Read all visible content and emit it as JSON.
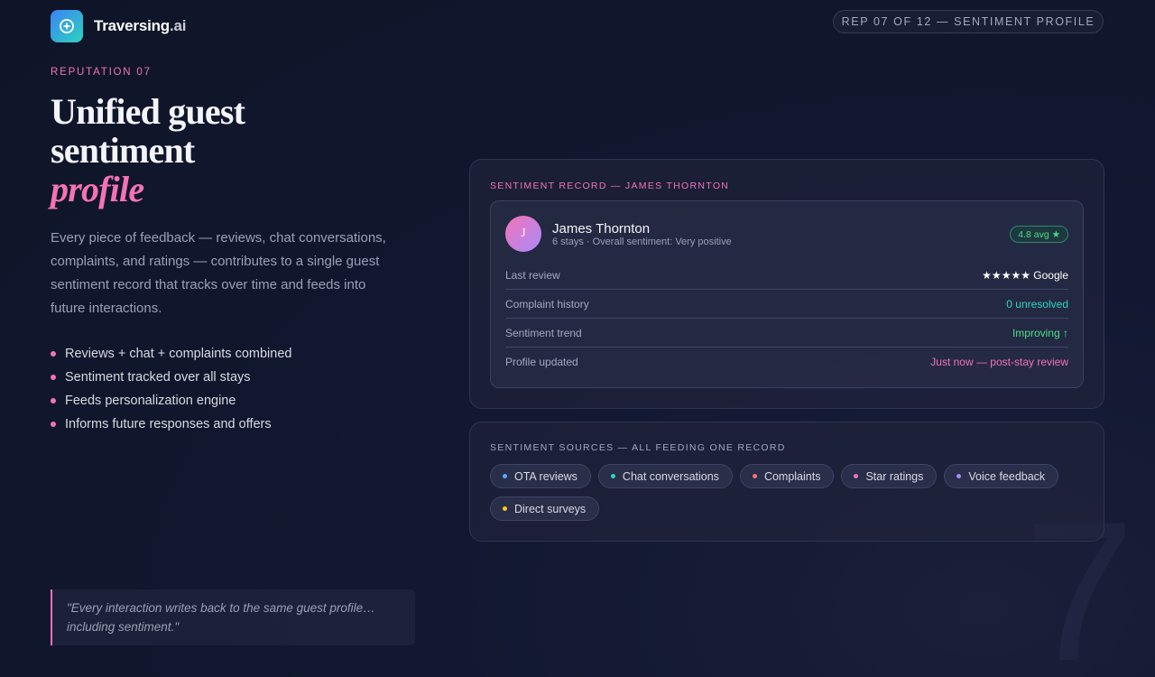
{
  "brand": {
    "name": "Traversing",
    "suffix": ".ai",
    "icon": "compass-plus-icon"
  },
  "rep_indicator": "REP 07 OF 12 — SENTIMENT PROFILE",
  "hero": {
    "eyebrow": "REPUTATION 07",
    "title_line1": "Unified guest",
    "title_line2": "sentiment",
    "title_accent": "profile",
    "description": "Every piece of feedback — reviews, chat conversations, complaints, and ratings — contributes to a single guest sentiment record that tracks over time and feeds into future interactions."
  },
  "bullets": [
    "Reviews + chat + complaints combined",
    "Sentiment tracked over all stays",
    "Feeds personalization engine",
    "Informs future responses and offers"
  ],
  "quote": "\"Every interaction writes back to the same guest profile… including sentiment.\"",
  "record": {
    "label": "SENTIMENT RECORD — JAMES THORNTON",
    "avatar_initial": "J",
    "guest_name": "James Thornton",
    "guest_meta": "6 stays · Overall sentiment: Very positive",
    "rating_badge": "4.8 avg ★",
    "rows": [
      {
        "key": "Last review",
        "value": "★★★★★ Google",
        "color": "#ffffff"
      },
      {
        "key": "Complaint history",
        "value": "0 unresolved",
        "color": "#2dd4bf"
      },
      {
        "key": "Sentiment trend",
        "value": "Improving ↑",
        "color": "#4ade80"
      },
      {
        "key": "Profile updated",
        "value": "Just now — post-stay review",
        "color": "#f472b6"
      }
    ]
  },
  "sources": {
    "label": "SENTIMENT SOURCES — ALL FEEDING ONE RECORD",
    "chips": [
      {
        "label": "OTA reviews",
        "dot": "#60a5fa"
      },
      {
        "label": "Chat conversations",
        "dot": "#2dd4bf"
      },
      {
        "label": "Complaints",
        "dot": "#f87171"
      },
      {
        "label": "Star ratings",
        "dot": "#f472b6"
      },
      {
        "label": "Voice feedback",
        "dot": "#a78bfa"
      },
      {
        "label": "Direct surveys",
        "dot": "#facc15"
      }
    ]
  },
  "watermark_number": "7",
  "colors": {
    "accent": "#f472b6",
    "teal": "#2dd4bf",
    "green": "#4ade80",
    "background": "#0f1528"
  }
}
